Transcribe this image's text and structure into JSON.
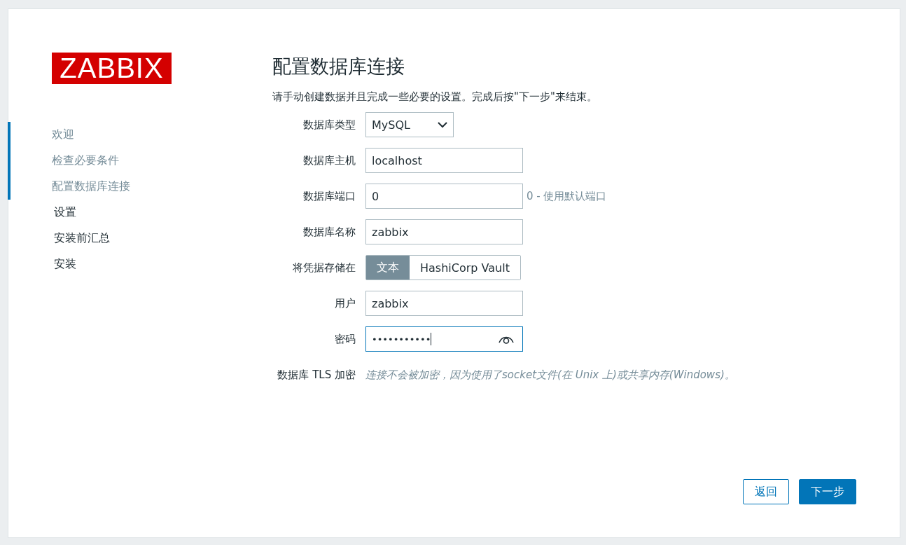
{
  "logo": "ZABBIX",
  "steps": [
    {
      "label": "欢迎",
      "done": true
    },
    {
      "label": "检查必要条件",
      "done": true
    },
    {
      "label": "配置数据库连接",
      "done": true
    },
    {
      "label": "设置",
      "done": false
    },
    {
      "label": "安装前汇总",
      "done": false
    },
    {
      "label": "安装",
      "done": false
    }
  ],
  "title": "配置数据库连接",
  "intro": "请手动创建数据并且完成一些必要的设置。完成后按\"下一步\"来结束。",
  "fields": [
    {
      "kind": "select",
      "label": "数据库类型",
      "value": "MySQL"
    },
    {
      "kind": "text",
      "label": "数据库主机",
      "value": "localhost"
    },
    {
      "kind": "text",
      "label": "数据库端口",
      "value": "0",
      "hint": "0 - 使用默认端口"
    },
    {
      "kind": "text",
      "label": "数据库名称",
      "value": "zabbix"
    },
    {
      "kind": "toggle",
      "label": "将凭据存储在",
      "options": [
        {
          "label": "文本",
          "selected": true
        },
        {
          "label": "HashiCorp Vault",
          "selected": false
        }
      ]
    },
    {
      "kind": "text",
      "label": "用户",
      "value": "zabbix"
    },
    {
      "kind": "password",
      "label": "密码",
      "value": "•••••••••••"
    },
    {
      "kind": "note",
      "label": "数据库 TLS 加密",
      "value": "连接不会被加密，因为使用了socket文件(在 Unix 上)或共享内存(Windows)。"
    }
  ],
  "buttons": [
    {
      "label": "返回",
      "kind": "secondary"
    },
    {
      "label": "下一步",
      "kind": "primary"
    }
  ]
}
